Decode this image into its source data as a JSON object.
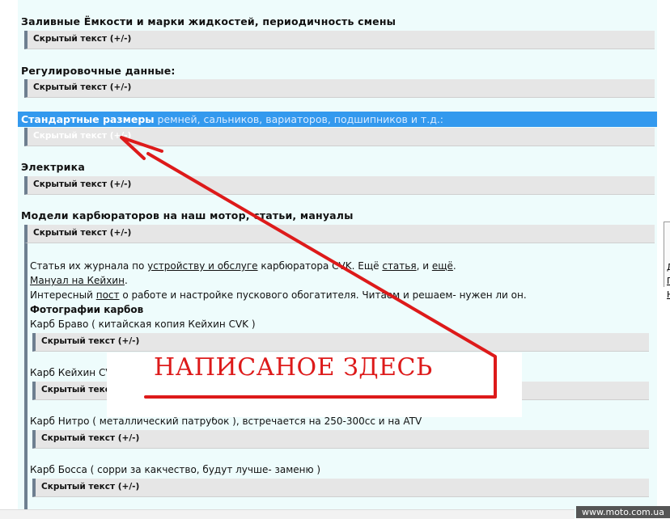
{
  "sections": {
    "capacities_heading": "Заливные Ёмкости и марки жидкостей, периодичность смены",
    "adjust_heading": "Регулировочные данные:",
    "sizes_heading_bold": "Стандартные размеры",
    "sizes_heading_rest": " ремней, сальников, вариаторов, подшипников и т.д.:",
    "electrics_heading": "Электрика",
    "carb_heading": "Модели карбюраторов на наш мотор, статьи, мануалы"
  },
  "spoiler_label": "Скрытый текст (+/-)",
  "article": {
    "line1_pre": "Статья их журнала по ",
    "line1_link1": "устройству и обслуге",
    "line1_mid": " карбюратора CVK. Ещё ",
    "line1_link2": "статья",
    "line1_sep": ", и ",
    "line1_link3": "ещё",
    "line1_end": ".",
    "manual_link": "Мануал на Кейхин",
    "manual_end": ".",
    "line3_pre": "Интересный ",
    "line3_link": "пост",
    "line3_rest": " о работе и настройке пускового обогатителя. Читаем и решаем- нужен ли он.",
    "photos_heading": "Фотографии карбов",
    "carb1": "Карб Браво ( китайская копия Кейхин CVK )",
    "carb2": "Карб Кейхин CV",
    "carb3": "Карб Нитро ( металлический патрубок ), встречается на 250-300сс и на ATV",
    "carb4": "Карб Босса ( сорри за какчество, будут лучше- заменю )"
  },
  "annotation_text": "НАПИСАНОЕ ЗДЕСЬ",
  "watermark": "www.moto.com.ua",
  "right_links": [
    "Д",
    "П",
    "Н"
  ],
  "colors": {
    "highlight": "#3399ee",
    "annotation_red": "#dd1a1a",
    "panel_bg": "#eefcfc"
  }
}
